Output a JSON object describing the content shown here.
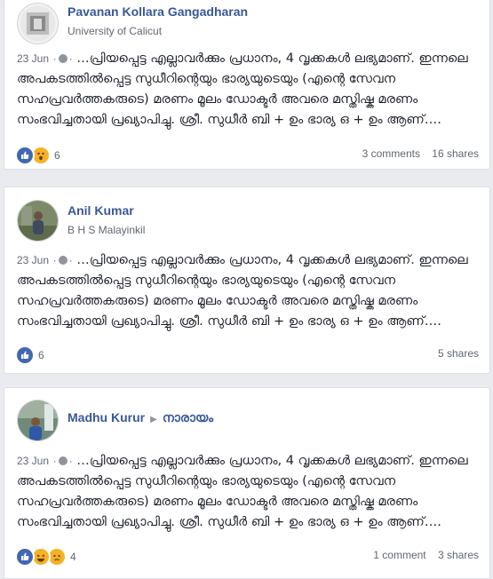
{
  "posts": [
    {
      "author": "Pavanan Kollara Gangadharan",
      "subtitle": "University of Calicut",
      "date": "23 Jun",
      "separator": "·",
      "text": "…പ്രിയപ്പെട്ട എല്ലാവർക്കും പ്രധാനം, 4 വൃക്കകൾ ലഭ്യമാണ്. ഇന്നലെ അപകടത്തിൽപ്പെട്ട സുധീറിന്റെയും ഭാര്യയുടെയും (എന്റെ സേവന സഹപ്രവർത്തകരുടെ) മരണം മൂലം ഡോക്ടർ അവരെ മസ്തിഷ്ക മരണം സംഭവിച്ചതായി പ്രഖ്യാപിച്ചു. ശ്രീ. സുധീർ ബി + ഉം ഭാര്യ ഒ + ഉം ആണ്….",
      "reaction_count": "6",
      "comments": "3 comments",
      "shares": "16 shares"
    },
    {
      "author": "Anil Kumar",
      "subtitle": "B H S Malayinkil",
      "date": "23 Jun",
      "separator": "·",
      "text": "…പ്രിയപ്പെട്ട എല്ലാവർക്കും പ്രധാനം, 4 വൃക്കകൾ ലഭ്യമാണ്. ഇന്നലെ അപകടത്തിൽപ്പെട്ട സുധീറിന്റെയും ഭാര്യയുടെയും (എന്റെ സേവന സഹപ്രവർത്തകരുടെ) മരണം മൂലം ഡോക്ടർ അവരെ മസ്തിഷ്ക മരണം സംഭവിച്ചതായി പ്രഖ്യാപിച്ചു. ശ്രീ. സുധീർ ബി + ഉം ഭാര്യ ഒ + ഉം ആണ്….",
      "reaction_count": "6",
      "shares": "5 shares"
    },
    {
      "author": "Madhu Kurur",
      "group": "നാരായം",
      "date": "23 Jun",
      "separator": "·",
      "text": "…പ്രിയപ്പെട്ട എല്ലാവർക്കും പ്രധാനം, 4 വൃക്കകൾ ലഭ്യമാണ്. ഇന്നലെ അപകടത്തിൽപ്പെട്ട സുധീറിന്റെയും ഭാര്യയുടെയും (എന്റെ സേവന സഹപ്രവർത്തകരുടെ) മരണം മൂലം ഡോക്ടർ അവരെ മസ്തിഷ്ക മരണം സംഭവിച്ചതായി പ്രഖ്യാപിച്ചു. ശ്രീ. സുധീർ ബി + ഉം ഭാര്യ ഒ + ഉം ആണ്….",
      "reaction_count": "4",
      "comments": "1 comment",
      "shares": "3 shares"
    }
  ],
  "icons": {
    "privacy": "globe-icon",
    "like": "like-icon",
    "wow": "wow-icon",
    "haha": "haha-icon",
    "sad": "sad-icon",
    "arrow": "caret-right-icon"
  },
  "colors": {
    "background": "#e9ebee",
    "author_link": "#385898",
    "like_blue": "#4267b2",
    "emoji_yellow": "#f7b125"
  }
}
